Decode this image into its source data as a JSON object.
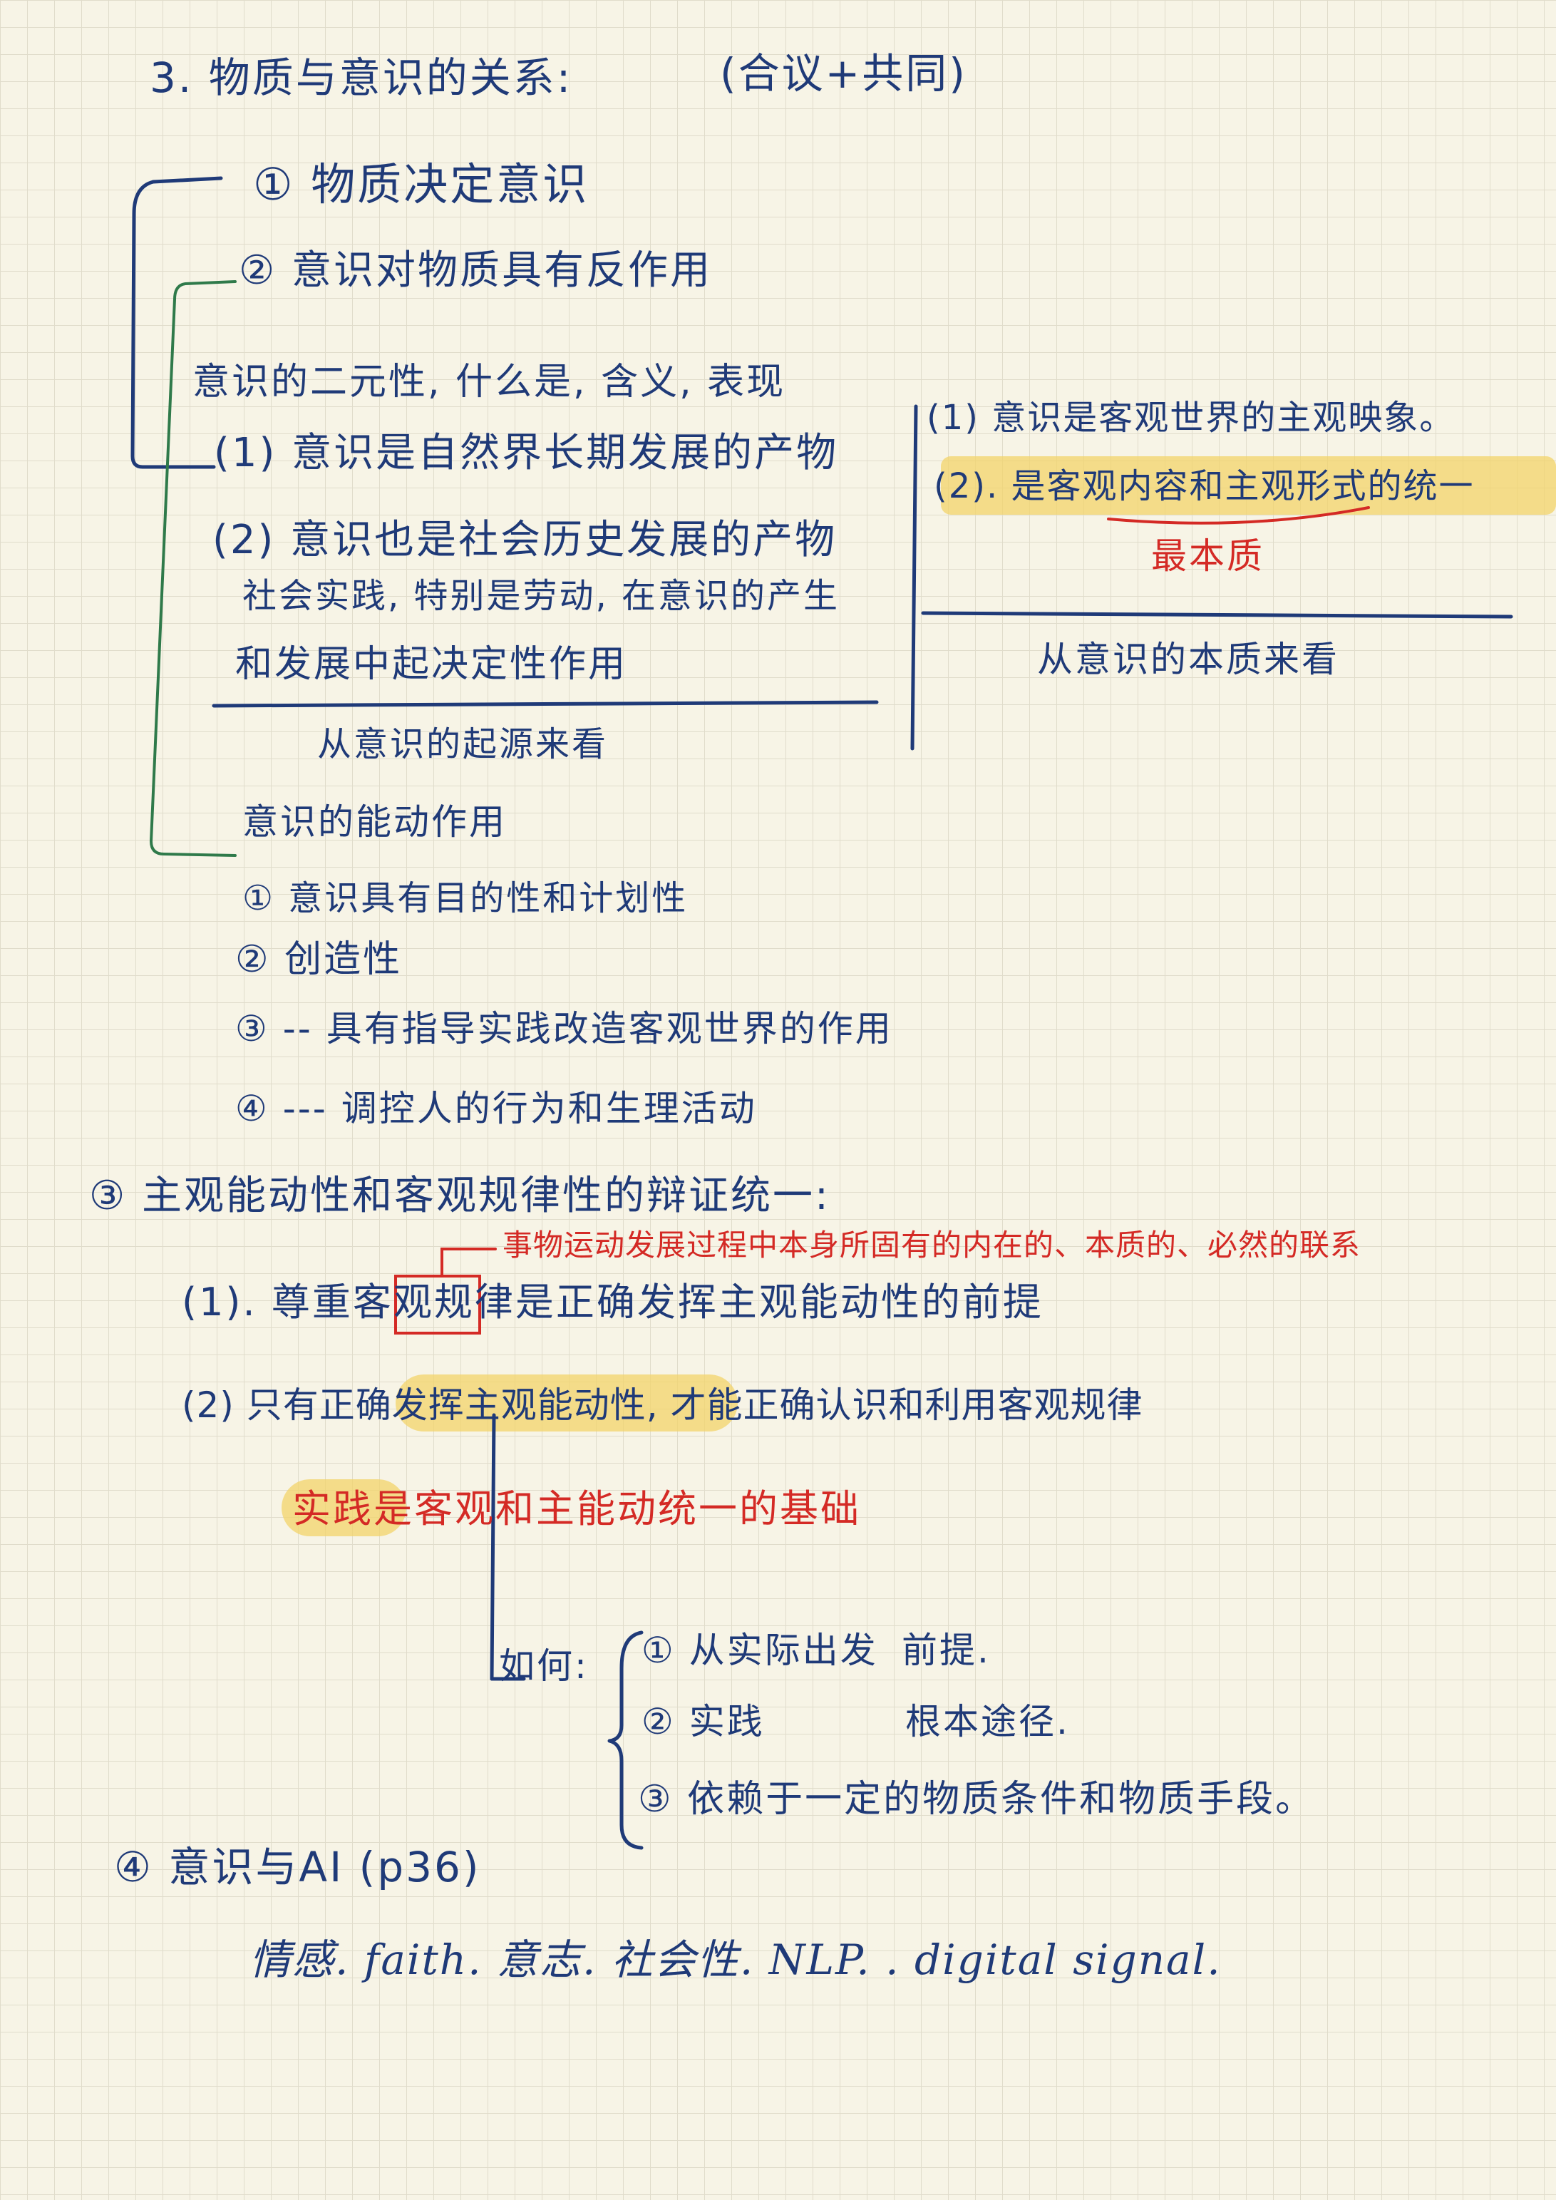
{
  "title": {
    "text": "3. 物质与意识的关系:",
    "note": "(合议+共同)"
  },
  "part1": {
    "text": "① 物质决定意识"
  },
  "part2": {
    "text": "② 意识对物质具有反作用"
  },
  "origin": {
    "heading": "意识的二元性, 什么是, 含义, 表现",
    "items": [
      "(1) 意识是自然界长期发展的产物",
      "(2) 意识也是社会历史发展的产物",
      "社会实践, 特别是劳动, 在意识的产生",
      "和发展中起决定性作用"
    ],
    "caption": "从意识的起源来看"
  },
  "essence": {
    "items": [
      "(1) 意识是客观世界的主观映象。",
      "(2). 是客观内容和主观形式的统一"
    ],
    "note": "最本质",
    "caption": "从意识的本质来看"
  },
  "initiative": {
    "heading": "意识的能动作用",
    "items": [
      "① 意识具有目的性和计划性",
      "② 创造性",
      "③ -- 具有指导实践改造客观世界的作用",
      "④ ---  调控人的行为和生理活动"
    ]
  },
  "part3": {
    "heading": "③ 主观能动性和客观规律性的辩证统一:",
    "law_note": "事物运动发展过程中本身所固有的内在的、本质的、必然的联系",
    "item1": "(1). 尊重客观规律是正确发挥主观能动性的前提",
    "item2": "(2) 只有正确发挥主观能动性, 才能正确认识和利用客观规律",
    "practice": "实践是客观和主能动统一的基础",
    "how": {
      "label": "如何:",
      "items": [
        {
          "text": "① 从实际出发",
          "tag": "前提."
        },
        {
          "text": "② 实践",
          "tag": "根本途径."
        },
        {
          "text": "③ 依赖于一定的物质条件和物质手段。",
          "tag": ""
        }
      ]
    }
  },
  "part4": {
    "heading": "④ 意识与AI (p36)",
    "keywords": "情感. faith. 意志. 社会性. NLP. . digital signal."
  },
  "colors": {
    "ink": "#1f3a78",
    "red_ink": "#d42a25",
    "green_ink": "#2f7a4a",
    "highlight": "#f3d46a",
    "paper": "#f7f4e6"
  }
}
